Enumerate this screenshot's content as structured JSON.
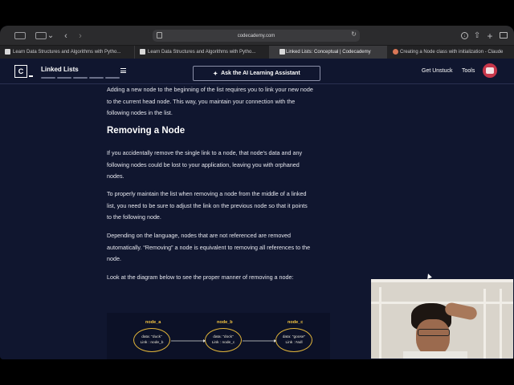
{
  "browser": {
    "url": "codecademy.com",
    "tabs": [
      {
        "label": "Learn Data Structures and Algorithms with Pytho...",
        "active": false,
        "favicon": "codecademy-icon"
      },
      {
        "label": "Learn Data Structures and Algorithms with Pytho...",
        "active": false,
        "favicon": "codecademy-icon"
      },
      {
        "label": "Linked Lists: Conceptual | Codecademy",
        "active": true,
        "favicon": "codecademy-icon"
      },
      {
        "label": "Creating a Node class with initialization - Claude",
        "active": false,
        "favicon": "claude-icon"
      }
    ]
  },
  "header": {
    "logo": "C",
    "course_title": "Linked Lists",
    "ai_button_label": "Ask the AI Learning Assistant",
    "nav": {
      "get_unstuck": "Get Unstuck",
      "tools": "Tools"
    }
  },
  "article": {
    "intro_lines": [
      "Adding a new node to the beginning of the list requires you to link your new node",
      "to the current head node. This way, you maintain your connection with the",
      "following nodes in the list."
    ],
    "heading": "Removing a Node",
    "para1": [
      "If you accidentally remove the single link to a node, that node's data and any",
      "following nodes could be lost to your application, leaving you with orphaned",
      "nodes."
    ],
    "para2": [
      "To properly maintain the list when removing a node from the middle of a linked",
      "list, you need to be sure to adjust the link on the previous node so that it points",
      "to the following node."
    ],
    "para3": [
      "Depending on the language, nodes that are not referenced are removed",
      "automatically. “Removing” a node is equivalent to removing all references to the",
      "node."
    ],
    "para4": "Look at the diagram below to see the proper manner of removing a node:"
  },
  "diagram": {
    "nodes": [
      {
        "label": "node_a",
        "data": "data: \"duck\"",
        "link": "Link : node_b"
      },
      {
        "label": "node_b",
        "data": "data: \"dock\"",
        "link": "Link : node_c"
      },
      {
        "label": "node_c",
        "data": "data: \"goose\"",
        "link": "Link : Null"
      }
    ]
  },
  "colors": {
    "background": "#10162f",
    "node_accent": "#f5c542",
    "text": "#e6e7ee"
  }
}
